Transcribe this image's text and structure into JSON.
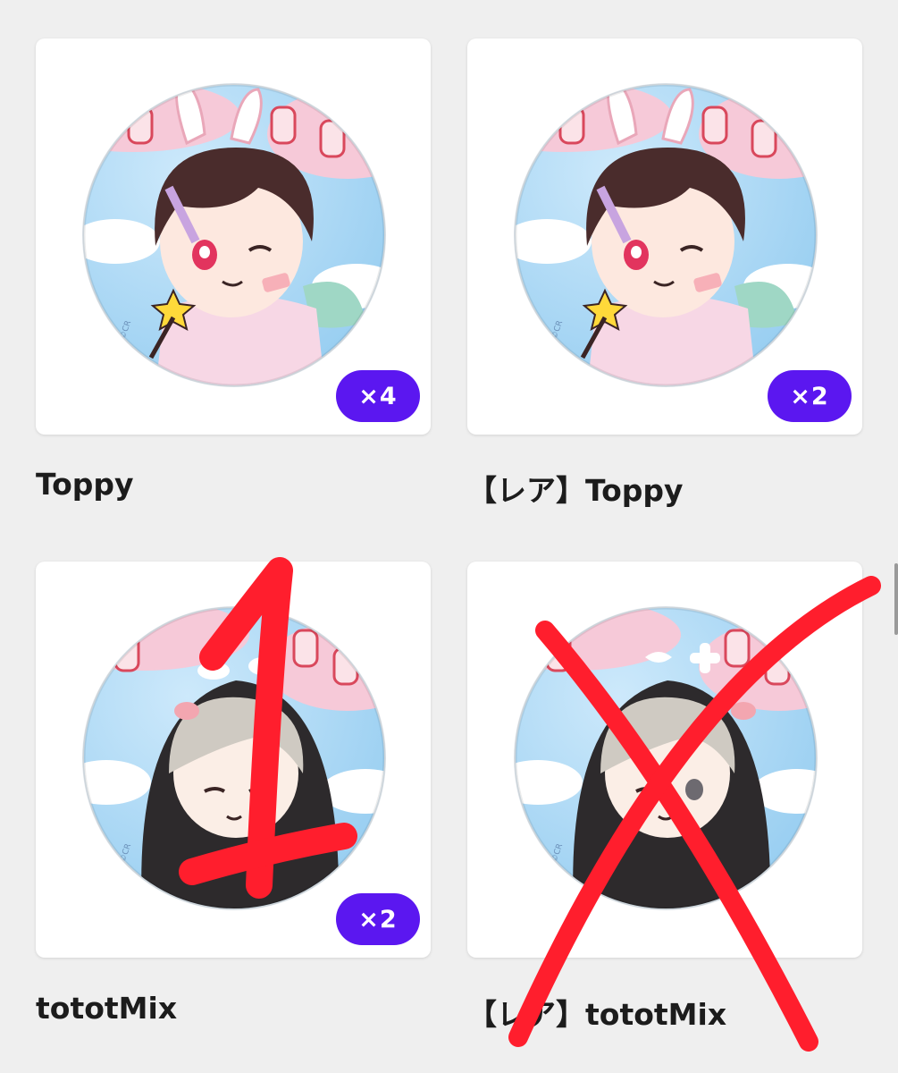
{
  "items": [
    {
      "name": "Toppy",
      "count": "×4",
      "variant": "toppy"
    },
    {
      "name": "【レア】Toppy",
      "count": "×2",
      "variant": "toppy"
    },
    {
      "name": "tototMix",
      "count": "×2",
      "variant": "hood"
    },
    {
      "name": "【レア】tototMix",
      "count": "",
      "variant": "hood"
    }
  ],
  "badge_copyright": "©CR",
  "colors": {
    "chip": "#5b17f0",
    "background": "#efefef",
    "card": "#ffffff",
    "marker": "#ff1e2d"
  },
  "annotations": {
    "mark_on_item_3": "1",
    "mark_on_item_4": "X"
  }
}
